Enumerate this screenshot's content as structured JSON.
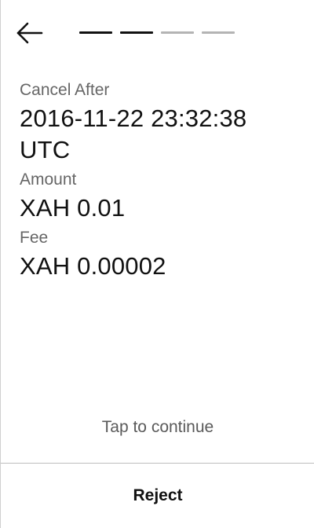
{
  "header": {
    "back_icon": "arrow-left-icon",
    "progress": {
      "total_steps": 4,
      "completed_steps": 2
    }
  },
  "fields": [
    {
      "label": "Cancel After",
      "value": "2016-11-22 23:32:38 UTC"
    },
    {
      "label": "Amount",
      "value": "XAH 0.01"
    },
    {
      "label": "Fee",
      "value": "XAH 0.00002"
    }
  ],
  "footer": {
    "hint": "Tap to continue",
    "reject_label": "Reject"
  },
  "colors": {
    "text_primary": "#111111",
    "text_secondary": "#666666",
    "step_done": "#111111",
    "step_pending": "#b4b4b4"
  }
}
